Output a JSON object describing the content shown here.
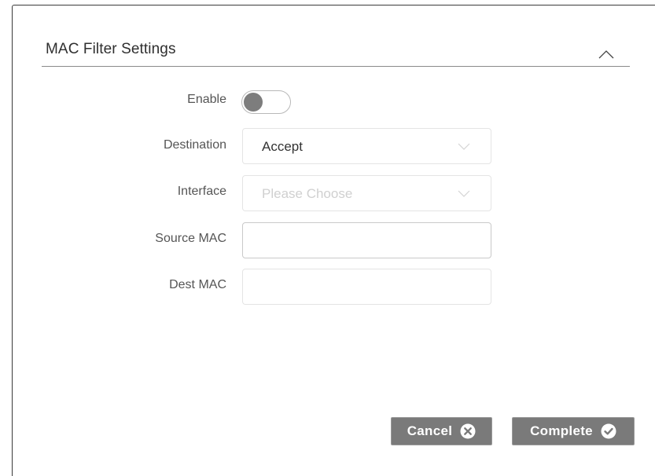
{
  "section": {
    "title": "MAC Filter Settings",
    "collapse_icon": "chevron-up-icon"
  },
  "form": {
    "enable": {
      "label": "Enable",
      "value": false
    },
    "destination": {
      "label": "Destination",
      "value": "Accept"
    },
    "interface": {
      "label": "Interface",
      "value": "",
      "placeholder": "Please Choose"
    },
    "source_mac": {
      "label": "Source MAC",
      "value": ""
    },
    "dest_mac": {
      "label": "Dest MAC",
      "value": ""
    }
  },
  "actions": {
    "cancel_label": "Cancel",
    "cancel_icon": "x-circle-icon",
    "complete_label": "Complete",
    "complete_icon": "check-circle-icon"
  },
  "colors": {
    "button_bg": "#7a7a7a",
    "toggle_knob": "#7d7d7d",
    "placeholder": "#d0d0d0"
  }
}
